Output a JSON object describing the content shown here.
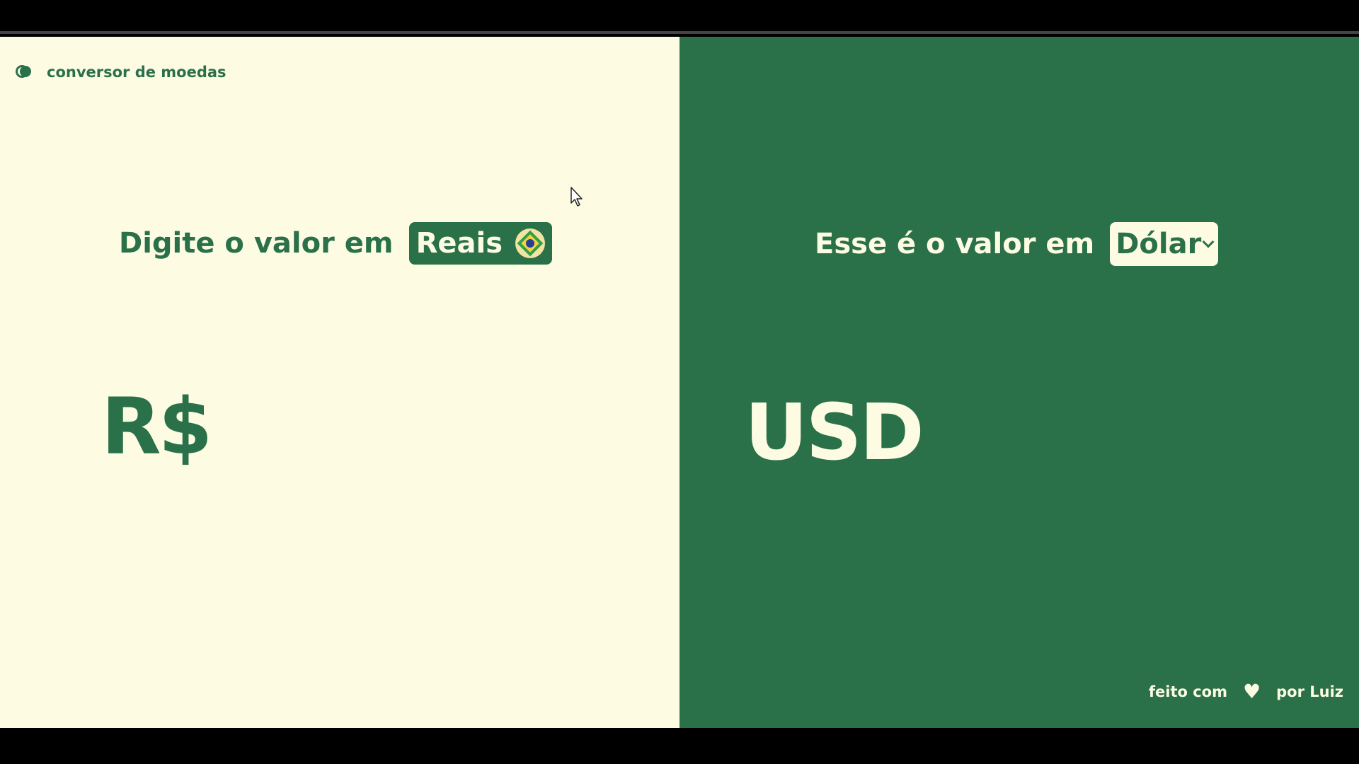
{
  "brand": {
    "title": "conversor de moedas",
    "logo_icon": "toggle-circle-icon"
  },
  "input_section": {
    "heading": "Digite o valor em",
    "currency_name": "Reais",
    "currency_flag": "brazil-flag-icon",
    "currency_symbol": "R$",
    "value": ""
  },
  "output_section": {
    "heading": "Esse é o valor em",
    "selected_currency": "Dólar",
    "currency_symbol": "USD",
    "value": ""
  },
  "footer": {
    "prefix": "feito com",
    "icon": "heart-icon",
    "suffix": "por Luiz"
  },
  "colors": {
    "primary_green": "#2a714a",
    "cream": "#fdfce3"
  }
}
